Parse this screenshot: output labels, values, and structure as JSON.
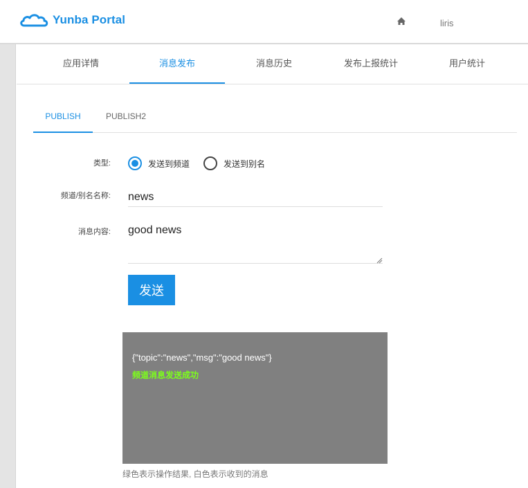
{
  "header": {
    "app_title": "Yunba Portal",
    "home_icon": "home-icon",
    "user_name": "liris",
    "brand_color": "#1a8fe3"
  },
  "main_tabs": [
    {
      "label": "应用详情",
      "active": false
    },
    {
      "label": "消息发布",
      "active": true
    },
    {
      "label": "消息历史",
      "active": false
    },
    {
      "label": "发布上报统计",
      "active": false
    },
    {
      "label": "用户统计",
      "active": false
    }
  ],
  "sub_tabs": [
    {
      "label": "PUBLISH",
      "active": true
    },
    {
      "label": "PUBLISH2",
      "active": false
    }
  ],
  "form": {
    "type_label": "类型:",
    "radio_options": [
      {
        "label": "发送到频道",
        "checked": true
      },
      {
        "label": "发送到别名",
        "checked": false
      }
    ],
    "name_label": "频道/别名名称:",
    "name_value": "news",
    "content_label": "消息内容:",
    "content_value": "good news",
    "send_label": "发送"
  },
  "console": {
    "received_message": "{\"topic\":\"news\",\"msg\":\"good news\"}",
    "result_message": "频道消息发送成功",
    "result_color": "#7cff1a",
    "background": "#808080"
  },
  "hint": "绿色表示操作结果, 白色表示收到的消息"
}
